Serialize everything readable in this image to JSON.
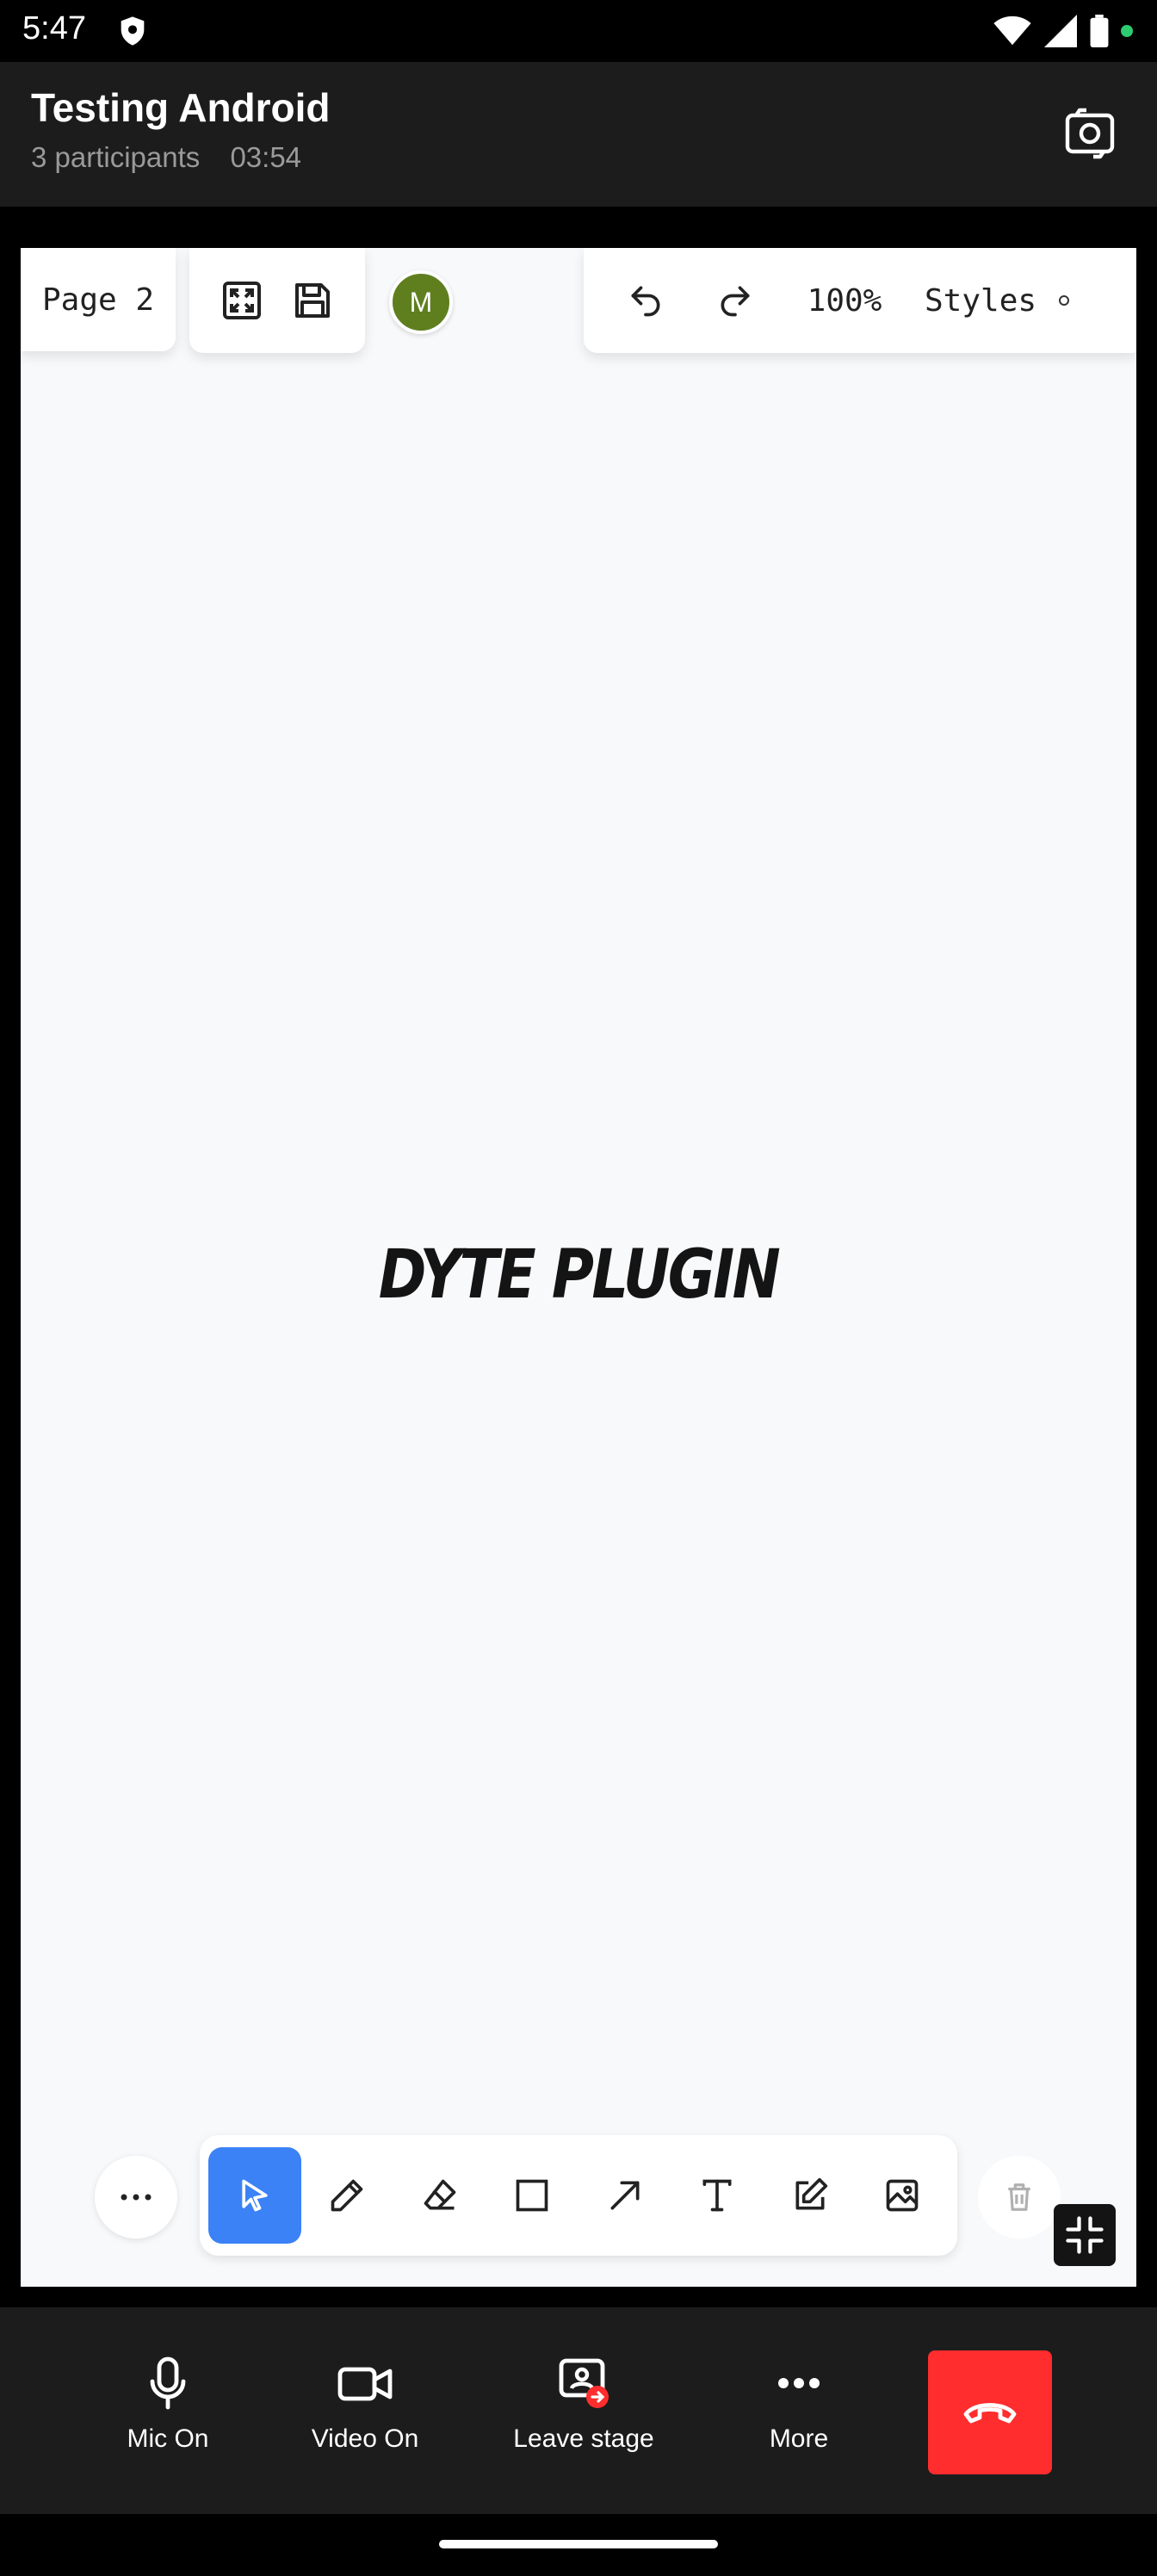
{
  "status_bar": {
    "time": "5:47"
  },
  "header": {
    "title": "Testing Android",
    "participants": "3 participants",
    "duration": "03:54"
  },
  "whiteboard": {
    "page_label": "Page 2",
    "avatar_initial": "M",
    "zoom": "100%",
    "styles_label": "Styles",
    "canvas_text": "DYTE PLUGIN",
    "tools": [
      "select",
      "pencil",
      "eraser",
      "rectangle",
      "arrow",
      "text",
      "sticky-note",
      "image"
    ],
    "active_tool": "select"
  },
  "controls": {
    "mic_label": "Mic On",
    "video_label": "Video On",
    "stage_label": "Leave stage",
    "more_label": "More"
  },
  "colors": {
    "accent": "#3b82f6",
    "end_call": "#ff2d2d",
    "avatar": "#5f7f1f",
    "header_bg": "#1c1c1c"
  }
}
